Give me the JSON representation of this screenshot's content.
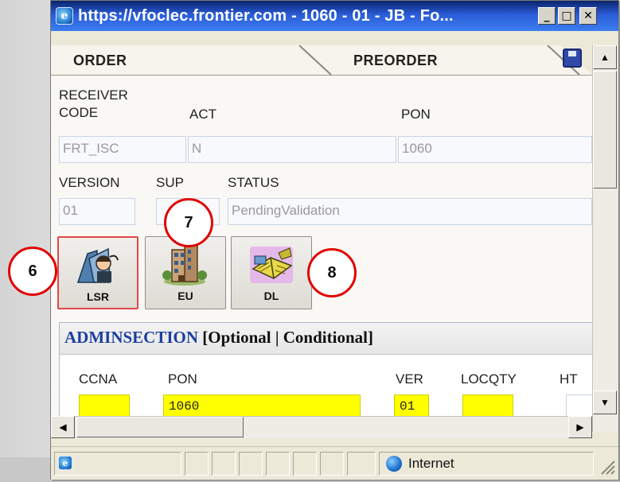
{
  "window": {
    "title": "https://vfoclec.frontier.com - 1060 - 01 - JB - Fo...",
    "controls": {
      "minimize": "_",
      "maximize": "□",
      "close": "✕"
    }
  },
  "tabs": [
    {
      "label": "ORDER"
    },
    {
      "label": "PREORDER"
    }
  ],
  "header_fields": {
    "receiver_code_label": "RECEIVER CODE",
    "receiver_code_value": "FRT_ISC",
    "act_label": "ACT",
    "act_value": "N",
    "pon_label": "PON",
    "pon_value": "1060",
    "version_label": "VERSION",
    "version_value": "01",
    "sup_label": "SUP",
    "sup_value": "",
    "status_label": "STATUS",
    "status_value": "PendingValidation"
  },
  "form_buttons": [
    {
      "label": "LSR",
      "icon": "lsr-icon"
    },
    {
      "label": "EU",
      "icon": "building-icon"
    },
    {
      "label": "DL",
      "icon": "directory-book-icon"
    }
  ],
  "callouts": [
    "6",
    "7",
    "8"
  ],
  "admin": {
    "title": "ADMINSECTION",
    "qualifier": "[Optional | Conditional]",
    "columns": [
      {
        "label": "CCNA",
        "value": ""
      },
      {
        "label": "PON",
        "value": "1060"
      },
      {
        "label": "VER",
        "value": "01"
      },
      {
        "label": "LOCQTY",
        "value": ""
      },
      {
        "label": "HT",
        "value": ""
      }
    ]
  },
  "statusbar": {
    "zone": "Internet"
  },
  "colors": {
    "title_bar": "#2a5bd7",
    "required_field": "#ffff00",
    "callout_ring": "#e00000",
    "section_title": "#1a3fa0"
  }
}
